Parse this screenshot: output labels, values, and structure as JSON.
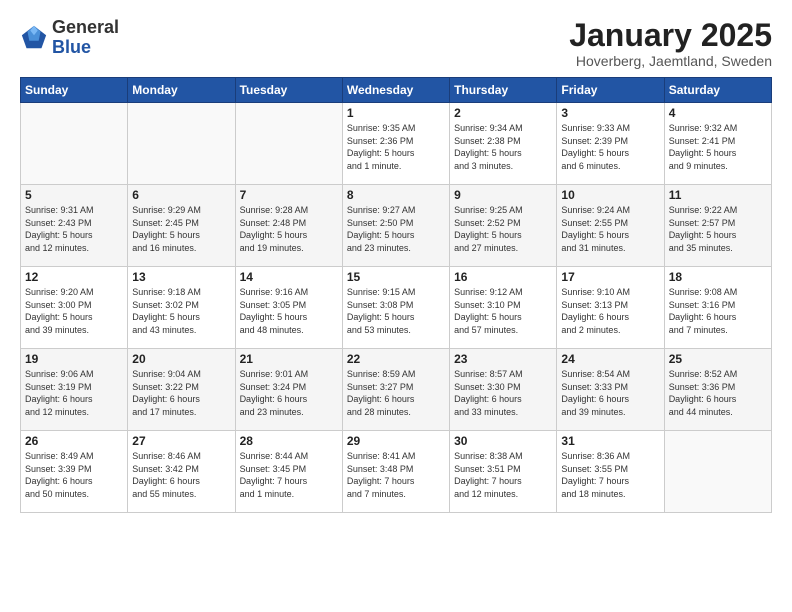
{
  "logo": {
    "general": "General",
    "blue": "Blue"
  },
  "header": {
    "title": "January 2025",
    "subtitle": "Hoverberg, Jaemtland, Sweden"
  },
  "weekdays": [
    "Sunday",
    "Monday",
    "Tuesday",
    "Wednesday",
    "Thursday",
    "Friday",
    "Saturday"
  ],
  "weeks": [
    [
      {
        "day": "",
        "info": ""
      },
      {
        "day": "",
        "info": ""
      },
      {
        "day": "",
        "info": ""
      },
      {
        "day": "1",
        "info": "Sunrise: 9:35 AM\nSunset: 2:36 PM\nDaylight: 5 hours\nand 1 minute."
      },
      {
        "day": "2",
        "info": "Sunrise: 9:34 AM\nSunset: 2:38 PM\nDaylight: 5 hours\nand 3 minutes."
      },
      {
        "day": "3",
        "info": "Sunrise: 9:33 AM\nSunset: 2:39 PM\nDaylight: 5 hours\nand 6 minutes."
      },
      {
        "day": "4",
        "info": "Sunrise: 9:32 AM\nSunset: 2:41 PM\nDaylight: 5 hours\nand 9 minutes."
      }
    ],
    [
      {
        "day": "5",
        "info": "Sunrise: 9:31 AM\nSunset: 2:43 PM\nDaylight: 5 hours\nand 12 minutes."
      },
      {
        "day": "6",
        "info": "Sunrise: 9:29 AM\nSunset: 2:45 PM\nDaylight: 5 hours\nand 16 minutes."
      },
      {
        "day": "7",
        "info": "Sunrise: 9:28 AM\nSunset: 2:48 PM\nDaylight: 5 hours\nand 19 minutes."
      },
      {
        "day": "8",
        "info": "Sunrise: 9:27 AM\nSunset: 2:50 PM\nDaylight: 5 hours\nand 23 minutes."
      },
      {
        "day": "9",
        "info": "Sunrise: 9:25 AM\nSunset: 2:52 PM\nDaylight: 5 hours\nand 27 minutes."
      },
      {
        "day": "10",
        "info": "Sunrise: 9:24 AM\nSunset: 2:55 PM\nDaylight: 5 hours\nand 31 minutes."
      },
      {
        "day": "11",
        "info": "Sunrise: 9:22 AM\nSunset: 2:57 PM\nDaylight: 5 hours\nand 35 minutes."
      }
    ],
    [
      {
        "day": "12",
        "info": "Sunrise: 9:20 AM\nSunset: 3:00 PM\nDaylight: 5 hours\nand 39 minutes."
      },
      {
        "day": "13",
        "info": "Sunrise: 9:18 AM\nSunset: 3:02 PM\nDaylight: 5 hours\nand 43 minutes."
      },
      {
        "day": "14",
        "info": "Sunrise: 9:16 AM\nSunset: 3:05 PM\nDaylight: 5 hours\nand 48 minutes."
      },
      {
        "day": "15",
        "info": "Sunrise: 9:15 AM\nSunset: 3:08 PM\nDaylight: 5 hours\nand 53 minutes."
      },
      {
        "day": "16",
        "info": "Sunrise: 9:12 AM\nSunset: 3:10 PM\nDaylight: 5 hours\nand 57 minutes."
      },
      {
        "day": "17",
        "info": "Sunrise: 9:10 AM\nSunset: 3:13 PM\nDaylight: 6 hours\nand 2 minutes."
      },
      {
        "day": "18",
        "info": "Sunrise: 9:08 AM\nSunset: 3:16 PM\nDaylight: 6 hours\nand 7 minutes."
      }
    ],
    [
      {
        "day": "19",
        "info": "Sunrise: 9:06 AM\nSunset: 3:19 PM\nDaylight: 6 hours\nand 12 minutes."
      },
      {
        "day": "20",
        "info": "Sunrise: 9:04 AM\nSunset: 3:22 PM\nDaylight: 6 hours\nand 17 minutes."
      },
      {
        "day": "21",
        "info": "Sunrise: 9:01 AM\nSunset: 3:24 PM\nDaylight: 6 hours\nand 23 minutes."
      },
      {
        "day": "22",
        "info": "Sunrise: 8:59 AM\nSunset: 3:27 PM\nDaylight: 6 hours\nand 28 minutes."
      },
      {
        "day": "23",
        "info": "Sunrise: 8:57 AM\nSunset: 3:30 PM\nDaylight: 6 hours\nand 33 minutes."
      },
      {
        "day": "24",
        "info": "Sunrise: 8:54 AM\nSunset: 3:33 PM\nDaylight: 6 hours\nand 39 minutes."
      },
      {
        "day": "25",
        "info": "Sunrise: 8:52 AM\nSunset: 3:36 PM\nDaylight: 6 hours\nand 44 minutes."
      }
    ],
    [
      {
        "day": "26",
        "info": "Sunrise: 8:49 AM\nSunset: 3:39 PM\nDaylight: 6 hours\nand 50 minutes."
      },
      {
        "day": "27",
        "info": "Sunrise: 8:46 AM\nSunset: 3:42 PM\nDaylight: 6 hours\nand 55 minutes."
      },
      {
        "day": "28",
        "info": "Sunrise: 8:44 AM\nSunset: 3:45 PM\nDaylight: 7 hours\nand 1 minute."
      },
      {
        "day": "29",
        "info": "Sunrise: 8:41 AM\nSunset: 3:48 PM\nDaylight: 7 hours\nand 7 minutes."
      },
      {
        "day": "30",
        "info": "Sunrise: 8:38 AM\nSunset: 3:51 PM\nDaylight: 7 hours\nand 12 minutes."
      },
      {
        "day": "31",
        "info": "Sunrise: 8:36 AM\nSunset: 3:55 PM\nDaylight: 7 hours\nand 18 minutes."
      },
      {
        "day": "",
        "info": ""
      }
    ]
  ]
}
